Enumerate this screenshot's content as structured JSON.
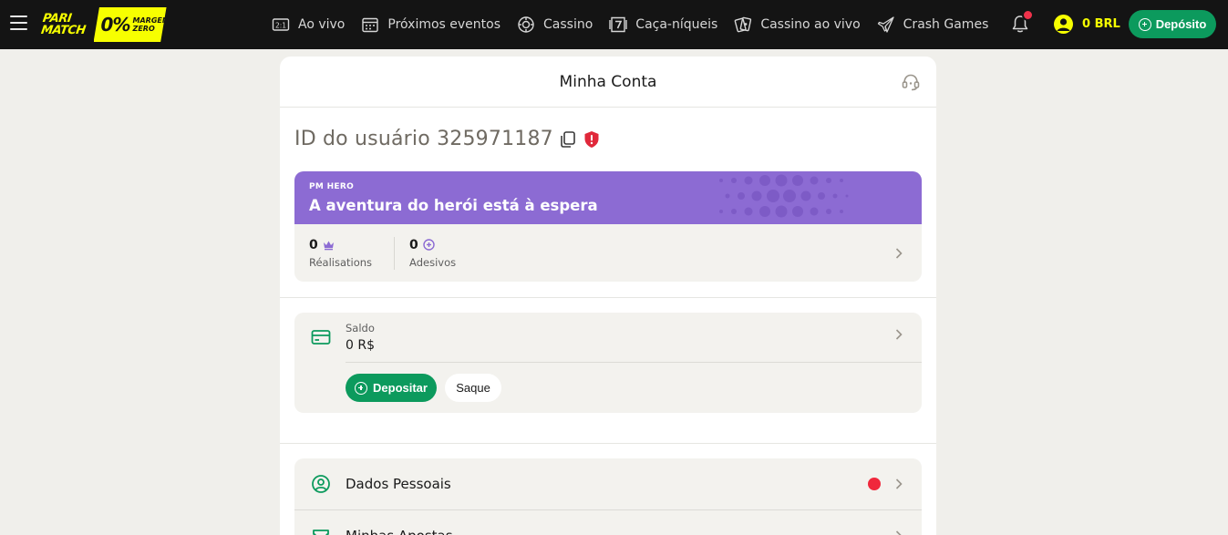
{
  "header": {
    "logo_text_1": "PARI",
    "logo_text_2": "MATCH",
    "badge_pct": "0%",
    "badge_line1": "MARGEM",
    "badge_line2": "ZERO",
    "nav": [
      {
        "label": "Ao vivo",
        "icon": "live-score-icon"
      },
      {
        "label": "Próximos eventos",
        "icon": "calendar-icon"
      },
      {
        "label": "Cassino",
        "icon": "casino-chip-icon"
      },
      {
        "label": "Caça-níqueis",
        "icon": "slot-seven-icon"
      },
      {
        "label": "Cassino ao vivo",
        "icon": "playing-cards-icon"
      },
      {
        "label": "Crash Games",
        "icon": "plane-icon"
      }
    ],
    "balance": "0 BRL",
    "deposit_label": "Depósito"
  },
  "panel": {
    "title": "Minha Conta",
    "user_id_text": "ID do usuário 325971187",
    "hero": {
      "tag": "PM HERO",
      "title": "A aventura do herói está à espera",
      "achievements_value": "0",
      "achievements_label": "Réalisations",
      "stickers_value": "0",
      "stickers_label": "Adesivos"
    },
    "balance": {
      "label": "Saldo",
      "value": "0 R$",
      "deposit_label": "Depositar",
      "withdraw_label": "Saque"
    },
    "menu": [
      {
        "label": "Dados Pessoais",
        "icon": "user-circle-icon",
        "alert": true
      },
      {
        "label": "Minhas Apostas",
        "icon": "ticket-icon",
        "alert": false
      }
    ]
  },
  "colors": {
    "brand_yellow": "#f7ff00",
    "accent_green": "#0c9a5d",
    "hero_purple": "#8c6bd3",
    "alert_red": "#f0283c"
  }
}
